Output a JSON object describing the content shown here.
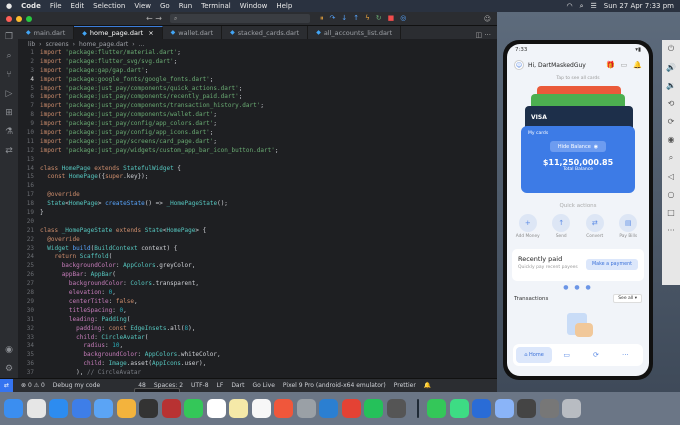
{
  "menubar": {
    "apple": "",
    "items": [
      "Code",
      "File",
      "Edit",
      "Selection",
      "View",
      "Go",
      "Run",
      "Terminal",
      "Window",
      "Help"
    ],
    "datetime": "Sun 27 Apr  7:33 pm"
  },
  "vscode": {
    "search_placeholder": "",
    "tabs": [
      {
        "label": "main.dart",
        "active": false
      },
      {
        "label": "home_page.dart",
        "active": true
      },
      {
        "label": "wallet.dart",
        "active": false
      },
      {
        "label": "stacked_cards.dart",
        "active": false
      },
      {
        "label": "all_accounts_list.dart",
        "active": false
      }
    ],
    "breadcrumb": [
      "lib",
      "›",
      "screens",
      "›",
      "home_page.dart",
      "›",
      "..."
    ],
    "code_lines": [
      {
        "n": "1",
        "segs": [
          [
            "kw",
            "import "
          ],
          [
            "str",
            "'package:flutter/material.dart'"
          ],
          [
            "plain",
            ";"
          ]
        ]
      },
      {
        "n": "2",
        "segs": [
          [
            "kw",
            "import "
          ],
          [
            "str",
            "'package:flutter_svg/svg.dart'"
          ],
          [
            "plain",
            ";"
          ]
        ]
      },
      {
        "n": "3",
        "segs": [
          [
            "kw",
            "import "
          ],
          [
            "str",
            "'package:gap/gap.dart'"
          ],
          [
            "plain",
            ";"
          ]
        ]
      },
      {
        "n": "4",
        "segs": [
          [
            "kw",
            "import "
          ],
          [
            "str",
            "'package:google_fonts/google_fonts.dart'"
          ],
          [
            "plain",
            ";"
          ]
        ]
      },
      {
        "n": "5",
        "segs": [
          [
            "kw",
            "import "
          ],
          [
            "str",
            "'package:just_pay/components/quick_actions.dart'"
          ],
          [
            "plain",
            ";"
          ]
        ]
      },
      {
        "n": "6",
        "segs": [
          [
            "kw",
            "import "
          ],
          [
            "str",
            "'package:just_pay/components/recently_paid.dart'"
          ],
          [
            "plain",
            ";"
          ]
        ]
      },
      {
        "n": "7",
        "segs": [
          [
            "kw",
            "import "
          ],
          [
            "str",
            "'package:just_pay/components/transaction_history.dart'"
          ],
          [
            "plain",
            ";"
          ]
        ]
      },
      {
        "n": "8",
        "segs": [
          [
            "kw",
            "import "
          ],
          [
            "str",
            "'package:just_pay/components/wallet.dart'"
          ],
          [
            "plain",
            ";"
          ]
        ]
      },
      {
        "n": "9",
        "segs": [
          [
            "kw",
            "import "
          ],
          [
            "str",
            "'package:just_pay/config/app_colors.dart'"
          ],
          [
            "plain",
            ";"
          ]
        ]
      },
      {
        "n": "10",
        "segs": [
          [
            "kw",
            "import "
          ],
          [
            "str",
            "'package:just_pay/config/app_icons.dart'"
          ],
          [
            "plain",
            ";"
          ]
        ]
      },
      {
        "n": "11",
        "segs": [
          [
            "kw",
            "import "
          ],
          [
            "str",
            "'package:just_pay/screens/card_page.dart'"
          ],
          [
            "plain",
            ";"
          ]
        ]
      },
      {
        "n": "12",
        "segs": [
          [
            "kw",
            "import "
          ],
          [
            "str",
            "'package:just_pay/widgets/custom_app_bar_icon_button.dart'"
          ],
          [
            "plain",
            ";"
          ]
        ]
      },
      {
        "n": "13",
        "segs": []
      },
      {
        "n": "14",
        "segs": [
          [
            "kw",
            "class "
          ],
          [
            "cls",
            "HomePage "
          ],
          [
            "kw",
            "extends "
          ],
          [
            "cls",
            "StatefulWidget "
          ],
          [
            "plain",
            "{"
          ]
        ]
      },
      {
        "n": "15",
        "segs": [
          [
            "plain",
            "  "
          ],
          [
            "kw",
            "const "
          ],
          [
            "cls",
            "HomePage"
          ],
          [
            "plain",
            "({"
          ],
          [
            "kw",
            "super"
          ],
          [
            "plain",
            ".key});"
          ]
        ]
      },
      {
        "n": "16",
        "segs": []
      },
      {
        "n": "17",
        "segs": [
          [
            "plain",
            "  "
          ],
          [
            "kw",
            "@override"
          ]
        ]
      },
      {
        "n": "18",
        "segs": [
          [
            "plain",
            "  "
          ],
          [
            "cls",
            "State"
          ],
          [
            "plain",
            "<"
          ],
          [
            "cls",
            "HomePage"
          ],
          [
            "plain",
            "> "
          ],
          [
            "fn",
            "createState"
          ],
          [
            "plain",
            "() => "
          ],
          [
            "cls",
            "_HomePageState"
          ],
          [
            "plain",
            "();"
          ]
        ]
      },
      {
        "n": "19",
        "segs": [
          [
            "plain",
            "}"
          ]
        ]
      },
      {
        "n": "20",
        "segs": []
      },
      {
        "n": "21",
        "segs": [
          [
            "kw",
            "class "
          ],
          [
            "cls",
            "_HomePageState "
          ],
          [
            "kw",
            "extends "
          ],
          [
            "cls",
            "State"
          ],
          [
            "plain",
            "<"
          ],
          [
            "cls",
            "HomePage"
          ],
          [
            "plain",
            "> {"
          ]
        ]
      },
      {
        "n": "22",
        "segs": [
          [
            "plain",
            "  "
          ],
          [
            "kw",
            "@override"
          ]
        ]
      },
      {
        "n": "23",
        "segs": [
          [
            "plain",
            "  "
          ],
          [
            "cls",
            "Widget "
          ],
          [
            "fn",
            "build"
          ],
          [
            "plain",
            "("
          ],
          [
            "cls",
            "BuildContext "
          ],
          [
            "plain",
            "context) {"
          ]
        ]
      },
      {
        "n": "24",
        "segs": [
          [
            "plain",
            "    "
          ],
          [
            "kw",
            "return "
          ],
          [
            "cls",
            "Scaffold"
          ],
          [
            "plain",
            "("
          ]
        ]
      },
      {
        "n": "25",
        "segs": [
          [
            "plain",
            "      "
          ],
          [
            "prop",
            "backgroundColor"
          ],
          [
            "plain",
            ": "
          ],
          [
            "cls",
            "AppColors"
          ],
          [
            "plain",
            ".greyColor,"
          ]
        ]
      },
      {
        "n": "26",
        "segs": [
          [
            "plain",
            "      "
          ],
          [
            "prop",
            "appBar"
          ],
          [
            "plain",
            ": "
          ],
          [
            "cls",
            "AppBar"
          ],
          [
            "plain",
            "("
          ]
        ]
      },
      {
        "n": "27",
        "segs": [
          [
            "plain",
            "        "
          ],
          [
            "prop",
            "backgroundColor"
          ],
          [
            "plain",
            ": "
          ],
          [
            "cls",
            "Colors"
          ],
          [
            "plain",
            ".transparent,"
          ]
        ]
      },
      {
        "n": "28",
        "segs": [
          [
            "plain",
            "        "
          ],
          [
            "prop",
            "elevation"
          ],
          [
            "plain",
            ": "
          ],
          [
            "num",
            "0"
          ],
          [
            "plain",
            ","
          ]
        ]
      },
      {
        "n": "29",
        "segs": [
          [
            "plain",
            "        "
          ],
          [
            "prop",
            "centerTitle"
          ],
          [
            "plain",
            ": "
          ],
          [
            "kw",
            "false"
          ],
          [
            "plain",
            ","
          ]
        ]
      },
      {
        "n": "30",
        "segs": [
          [
            "plain",
            "        "
          ],
          [
            "prop",
            "titleSpacing"
          ],
          [
            "plain",
            ": "
          ],
          [
            "num",
            "0"
          ],
          [
            "plain",
            ","
          ]
        ]
      },
      {
        "n": "31",
        "segs": [
          [
            "plain",
            "        "
          ],
          [
            "prop",
            "leading"
          ],
          [
            "plain",
            ": "
          ],
          [
            "cls",
            "Padding"
          ],
          [
            "plain",
            "("
          ]
        ]
      },
      {
        "n": "32",
        "segs": [
          [
            "plain",
            "          "
          ],
          [
            "prop",
            "padding"
          ],
          [
            "plain",
            ": "
          ],
          [
            "kw",
            "const "
          ],
          [
            "cls",
            "EdgeInsets"
          ],
          [
            "plain",
            ".all("
          ],
          [
            "num",
            "8"
          ],
          [
            "plain",
            "),"
          ]
        ]
      },
      {
        "n": "33",
        "segs": [
          [
            "plain",
            "          "
          ],
          [
            "prop",
            "child"
          ],
          [
            "plain",
            ": "
          ],
          [
            "cls",
            "CircleAvatar"
          ],
          [
            "plain",
            "("
          ]
        ]
      },
      {
        "n": "34",
        "segs": [
          [
            "plain",
            "            "
          ],
          [
            "prop",
            "radius"
          ],
          [
            "plain",
            ": "
          ],
          [
            "num",
            "10"
          ],
          [
            "plain",
            ","
          ]
        ]
      },
      {
        "n": "35",
        "segs": [
          [
            "plain",
            "            "
          ],
          [
            "prop",
            "backgroundColor"
          ],
          [
            "plain",
            ": "
          ],
          [
            "cls",
            "AppColors"
          ],
          [
            "plain",
            ".whiteColor,"
          ]
        ]
      },
      {
        "n": "36",
        "segs": [
          [
            "plain",
            "            "
          ],
          [
            "prop",
            "child"
          ],
          [
            "plain",
            ": "
          ],
          [
            "cls",
            "Image"
          ],
          [
            "plain",
            ".asset("
          ],
          [
            "cls",
            "AppIcons"
          ],
          [
            "plain",
            ".user),"
          ]
        ]
      },
      {
        "n": "37",
        "segs": [
          [
            "plain",
            "          ), "
          ],
          [
            "cm",
            "// CircleAvatar"
          ]
        ]
      },
      {
        "n": "38",
        "segs": [
          [
            "plain",
            "        ), "
          ],
          [
            "cm",
            "// Padding"
          ]
        ]
      }
    ],
    "status": {
      "debug": "Debug my code",
      "position": "48",
      "spaces": "Spaces: 2",
      "encoding": "UTF-8",
      "eol": "LF",
      "lang": "Dart",
      "golive": "Go Live",
      "device": "Pixel 9 Pro (android-x64 emulator)",
      "prettier": "Prettier"
    },
    "tooltip": "Screenshot"
  },
  "phone": {
    "greeting": "Hi, DartMaskedGuy",
    "tap_info": "Tap to see all cards",
    "card_label": "My cards",
    "hide_balance": "Hide Balance",
    "balance": "$11,250,000.85",
    "balance_label": "Total Balance",
    "quick_actions_title": "Quick actions",
    "quick_actions": [
      "Add Money",
      "Send",
      "Convert",
      "Pay Bills"
    ],
    "recent_title": "Recently paid",
    "recent_sub": "Quickly pay recent payees",
    "make_payment": "Make a payment",
    "transactions": "Transactions",
    "see_all": "See all",
    "nav_home": "Home",
    "visa": "VISA"
  },
  "colors": {
    "accent": "#3d7be6",
    "editor_bg": "#1e1f22"
  }
}
